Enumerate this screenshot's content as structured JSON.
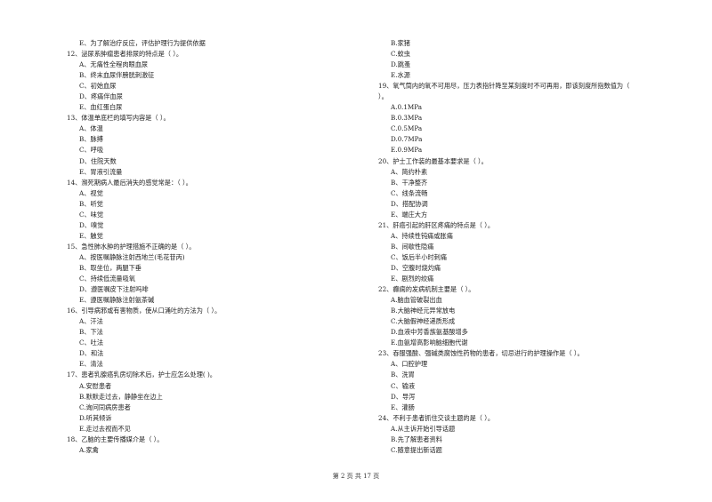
{
  "left_column": [
    {
      "type": "opt",
      "text": "E、为了解治疗反应，评估护理行为提供依据"
    },
    {
      "type": "q",
      "text": "12、泌尿系肿瘤患者排尿的特点是（    ）。"
    },
    {
      "type": "opt",
      "text": "A、无痛性全程肉眼血尿"
    },
    {
      "type": "opt",
      "text": "B、终末血尿伴膀胱刺激征"
    },
    {
      "type": "opt",
      "text": "C、初始血尿"
    },
    {
      "type": "opt",
      "text": "D、疼痛伴血尿"
    },
    {
      "type": "opt",
      "text": "E、血红蛋白尿"
    },
    {
      "type": "q",
      "text": "13、体温单底栏的填写内容是（    ）。"
    },
    {
      "type": "opt",
      "text": "A、体温"
    },
    {
      "type": "opt",
      "text": "B、脉搏"
    },
    {
      "type": "opt",
      "text": "C、呼吸"
    },
    {
      "type": "opt",
      "text": "D、住院天数"
    },
    {
      "type": "opt",
      "text": "E、胃液引流量"
    },
    {
      "type": "q",
      "text": "14、濒死期病人最后消失的感觉常是：（    ）。"
    },
    {
      "type": "opt",
      "text": "A、视觉"
    },
    {
      "type": "opt",
      "text": "B、听觉"
    },
    {
      "type": "opt",
      "text": "C、味觉"
    },
    {
      "type": "opt",
      "text": "D、嗅觉"
    },
    {
      "type": "opt",
      "text": "E、触觉"
    },
    {
      "type": "q",
      "text": "15、急性肺水肿的护理措施不正确的是（    ）。"
    },
    {
      "type": "opt",
      "text": "A、按医嘱静脉注射西地兰(毛花苷丙)"
    },
    {
      "type": "opt",
      "text": "B、取坐位，两腿下垂"
    },
    {
      "type": "opt",
      "text": "C、持续低流量吸氧"
    },
    {
      "type": "opt",
      "text": "D、遵医嘱皮下注射吗啡"
    },
    {
      "type": "opt",
      "text": "E、遵医嘱静脉注射氨茶碱"
    },
    {
      "type": "q",
      "text": "16、引导病邪或有害物质，使从口涌吐的方法为（    ）。"
    },
    {
      "type": "opt",
      "text": "A、汗法"
    },
    {
      "type": "opt",
      "text": "B、下法"
    },
    {
      "type": "opt",
      "text": "C、吐法"
    },
    {
      "type": "opt",
      "text": "D、和法"
    },
    {
      "type": "opt",
      "text": "E、清法"
    },
    {
      "type": "q",
      "text": "17、患者乳腺癌乳房切除术后，护士应怎么处理(    )。"
    },
    {
      "type": "opt",
      "text": "A.安慰患者"
    },
    {
      "type": "opt",
      "text": "B.默默走过去，静静坐在边上"
    },
    {
      "type": "opt",
      "text": "C.询问同病房患者"
    },
    {
      "type": "opt",
      "text": "D.听其倾诉"
    },
    {
      "type": "opt",
      "text": "E.走过去视而不见"
    },
    {
      "type": "q",
      "text": "18、乙脑的主要传播媒介是（    ）。"
    },
    {
      "type": "opt",
      "text": "A.家禽"
    }
  ],
  "right_column": [
    {
      "type": "opt",
      "text": "B.家猪"
    },
    {
      "type": "opt",
      "text": "C.蚊虫"
    },
    {
      "type": "opt",
      "text": "D.跳蚤"
    },
    {
      "type": "opt",
      "text": "E.水源"
    },
    {
      "type": "q",
      "text": "19、氧气筒内的氧不可用尽，压力表指针降至某刻度时不可再用，即该刻度所指数值为（"
    },
    {
      "type": "q",
      "text": "）。"
    },
    {
      "type": "opt",
      "text": "A.0.1MPa"
    },
    {
      "type": "opt",
      "text": "B.0.3MPa"
    },
    {
      "type": "opt",
      "text": "C.0.5MPa"
    },
    {
      "type": "opt",
      "text": "D.0.7MPa"
    },
    {
      "type": "opt",
      "text": "E.0.9MPa"
    },
    {
      "type": "q",
      "text": "20、护士工作装的最基本要求是（    ）。"
    },
    {
      "type": "opt",
      "text": "A、简约朴素"
    },
    {
      "type": "opt",
      "text": "B、干净整齐"
    },
    {
      "type": "opt",
      "text": "C、线条流畅"
    },
    {
      "type": "opt",
      "text": "D、搭配协调"
    },
    {
      "type": "opt",
      "text": "E、端庄大方"
    },
    {
      "type": "q",
      "text": "21、肝癌引起的肝区疼痛的特点是（    ）。"
    },
    {
      "type": "opt",
      "text": "A、持续性钝痛或胀痛"
    },
    {
      "type": "opt",
      "text": "B、间歇性隐痛"
    },
    {
      "type": "opt",
      "text": "C、饭后半小时刺痛"
    },
    {
      "type": "opt",
      "text": "D、空腹时烧灼痛"
    },
    {
      "type": "opt",
      "text": "E、剧烈的绞痛"
    },
    {
      "type": "q",
      "text": "22、癫痫的发病机制主要是（    ）。"
    },
    {
      "type": "opt",
      "text": "A.脑血管破裂出血"
    },
    {
      "type": "opt",
      "text": "B.大脑神经元异常放电"
    },
    {
      "type": "opt",
      "text": "C.大脑假神经递质形成"
    },
    {
      "type": "opt",
      "text": "D.血液中芳香族氨基酸增多"
    },
    {
      "type": "opt",
      "text": "E.血氨增高影响脑细胞代谢"
    },
    {
      "type": "q",
      "text": "23、吞服强酸、强碱类腐蚀性药物的患者，切忌进行的护理操作是（    ）。"
    },
    {
      "type": "opt",
      "text": "A、口腔护理"
    },
    {
      "type": "opt",
      "text": "B、洗胃"
    },
    {
      "type": "opt",
      "text": "C、输液"
    },
    {
      "type": "opt",
      "text": "D、导泻"
    },
    {
      "type": "opt",
      "text": "E、灌肠"
    },
    {
      "type": "q",
      "text": "24、不利于患者抓住交谈主题的是（    ）。"
    },
    {
      "type": "opt",
      "text": "A.从主诉开始引导话题"
    },
    {
      "type": "opt",
      "text": "B.先了解患者资料"
    },
    {
      "type": "opt",
      "text": "C.随意提出新话题"
    }
  ],
  "footer": {
    "page_label": "第 2 页 共 17 页"
  }
}
